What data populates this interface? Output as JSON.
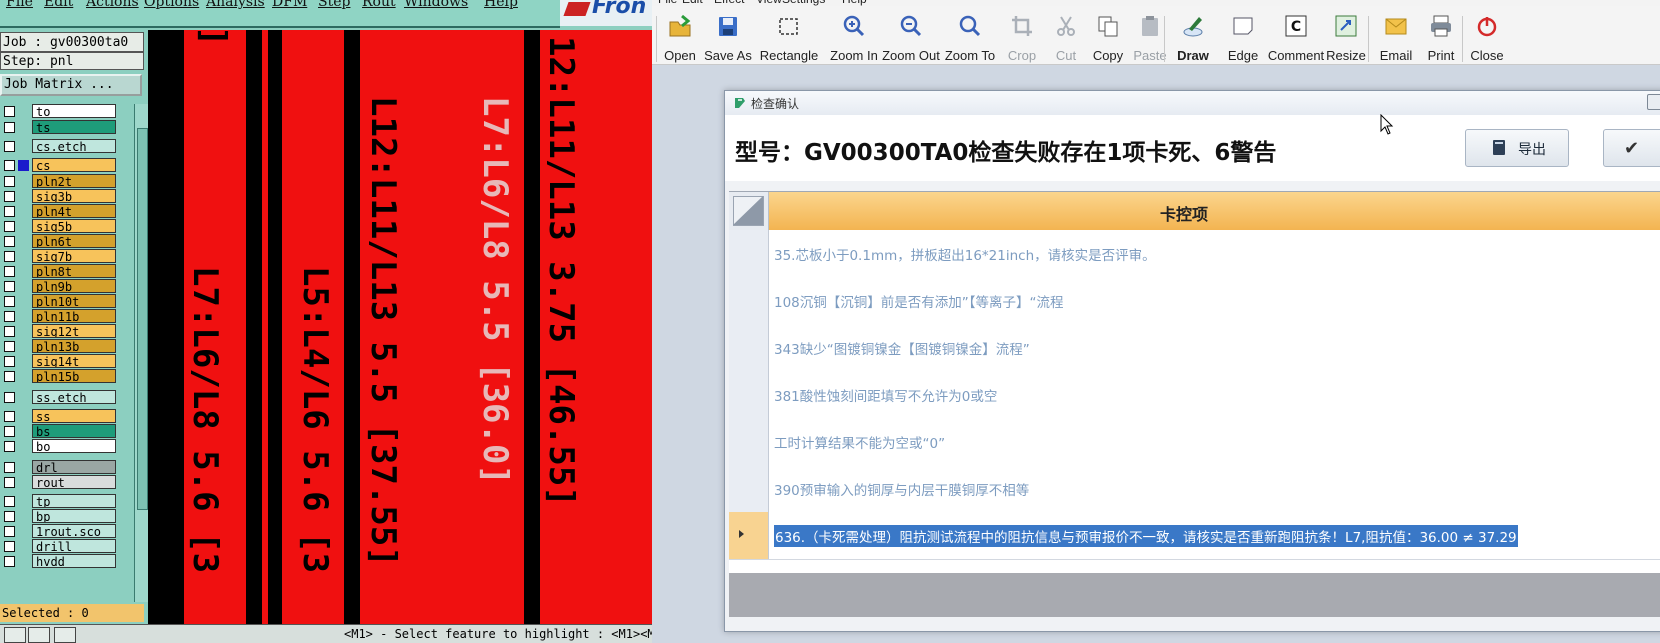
{
  "cad": {
    "menu": [
      "File",
      "Edit",
      "Actions",
      "Options",
      "Analysis",
      "DFM",
      "Step",
      "Rout",
      "Windows",
      "Help"
    ],
    "logo": "Fron",
    "job_label": "Job : gv00300ta0",
    "step_label": "Step: pnl",
    "job_matrix_button": "Job Matrix ...",
    "layers": [
      {
        "name": "to",
        "color": "#ffffff"
      },
      {
        "name": "ts",
        "color": "#1e9c7a"
      },
      {
        "name": "cs.etch",
        "color": "#bfe6dd"
      },
      {
        "name": "cs",
        "color": "#f7c35b",
        "active": true
      },
      {
        "name": "pln2t",
        "color": "#d4a12c"
      },
      {
        "name": "sig3b",
        "color": "#f7c35b"
      },
      {
        "name": "pln4t",
        "color": "#d4a12c"
      },
      {
        "name": "sig5b",
        "color": "#f7c35b"
      },
      {
        "name": "pln6t",
        "color": "#d4a12c"
      },
      {
        "name": "sig7b",
        "color": "#f7c35b"
      },
      {
        "name": "pln8t",
        "color": "#d4a12c"
      },
      {
        "name": "pln9b",
        "color": "#d4a12c"
      },
      {
        "name": "pln10t",
        "color": "#d4a12c"
      },
      {
        "name": "pln11b",
        "color": "#d4a12c"
      },
      {
        "name": "sig12t",
        "color": "#f7c35b"
      },
      {
        "name": "pln13b",
        "color": "#d4a12c"
      },
      {
        "name": "sig14t",
        "color": "#f7c35b"
      },
      {
        "name": "pln15b",
        "color": "#d4a12c"
      },
      {
        "name": "ss.etch",
        "color": "#bfe6dd"
      },
      {
        "name": "ss",
        "color": "#f7c35b"
      },
      {
        "name": "bs",
        "color": "#1e9c7a"
      },
      {
        "name": "bo",
        "color": "#ffffff"
      },
      {
        "name": "drl",
        "color": "#9aa7a4"
      },
      {
        "name": "rout",
        "color": "#d9dcdc"
      },
      {
        "name": "tp",
        "color": "#bfe6dd"
      },
      {
        "name": "bp",
        "color": "#bfe6dd"
      },
      {
        "name": "1rout.sco",
        "color": "#bfe6dd"
      },
      {
        "name": "drill",
        "color": "#bfe6dd"
      },
      {
        "name": "hvdd",
        "color": "#bfe6dd"
      }
    ],
    "selected": "Selected : 0",
    "status_message": "<M1> - Select feature to highlight : <M1><M",
    "canvas_labels": [
      "L7:L6/L8 5.6 [3",
      "L5:L4/L6 5.6 [3",
      "L12:L11/L13 5.5 [37.55]",
      "L7:L6/L8 5.5 [36.0]",
      "12:L11/L13 3.75 [46.55]",
      "]"
    ]
  },
  "toolbar": {
    "menu": [
      "File",
      "Edit",
      "Effect",
      "View",
      "Settings",
      "Help"
    ],
    "buttons": [
      {
        "label": "Open",
        "icon": "open-folder-icon",
        "enabled": true
      },
      {
        "label": "Save As",
        "icon": "save-icon",
        "enabled": true
      },
      {
        "label": "Rectangle",
        "icon": "rectangle-select-icon",
        "enabled": true
      },
      {
        "label": "Zoom In",
        "icon": "zoom-in-icon",
        "enabled": true
      },
      {
        "label": "Zoom Out",
        "icon": "zoom-out-icon",
        "enabled": true
      },
      {
        "label": "Zoom To",
        "icon": "zoom-to-icon",
        "enabled": true
      },
      {
        "label": "Crop",
        "icon": "crop-icon",
        "enabled": false
      },
      {
        "label": "Cut",
        "icon": "scissors-icon",
        "enabled": false
      },
      {
        "label": "Copy",
        "icon": "copy-icon",
        "enabled": true
      },
      {
        "label": "Paste",
        "icon": "paste-icon",
        "enabled": false
      },
      {
        "label": "Draw",
        "icon": "draw-icon",
        "enabled": true,
        "active": true
      },
      {
        "label": "Edge",
        "icon": "edge-icon",
        "enabled": true
      },
      {
        "label": "Comment",
        "icon": "comment-icon",
        "enabled": true
      },
      {
        "label": "Resize",
        "icon": "resize-icon",
        "enabled": true
      },
      {
        "label": "Email",
        "icon": "email-icon",
        "enabled": true
      },
      {
        "label": "Print",
        "icon": "printer-icon",
        "enabled": true
      },
      {
        "label": "Close",
        "icon": "power-icon",
        "enabled": true
      }
    ]
  },
  "dialog": {
    "title": "检查确认",
    "heading": "型号：GV00300TA0检查失败存在1项卡死、6警告",
    "export_label": "导出",
    "column_header": "卡控项",
    "rows": [
      "35.芯板小于0.1mm，拼板超出16*21inch，请核实是否评审。",
      "108沉铜【沉铜】前是否有添加”【等离子】“流程",
      "343缺少“图镀铜镍金【图镀铜镍金】流程”",
      "381酸性蚀刻间距填写不允许为0或空",
      "工时计算结果不能为空或“0”",
      "390预审输入的铜厚与内层干膜铜厚不相等",
      "636.（卡死需处理）阻抗测试流程中的阻抗信息与预审报价不一致，请核实是否重新跑阻抗条！L7,阻抗值：36.00 ≠ 37.29"
    ],
    "current_row": 6
  }
}
